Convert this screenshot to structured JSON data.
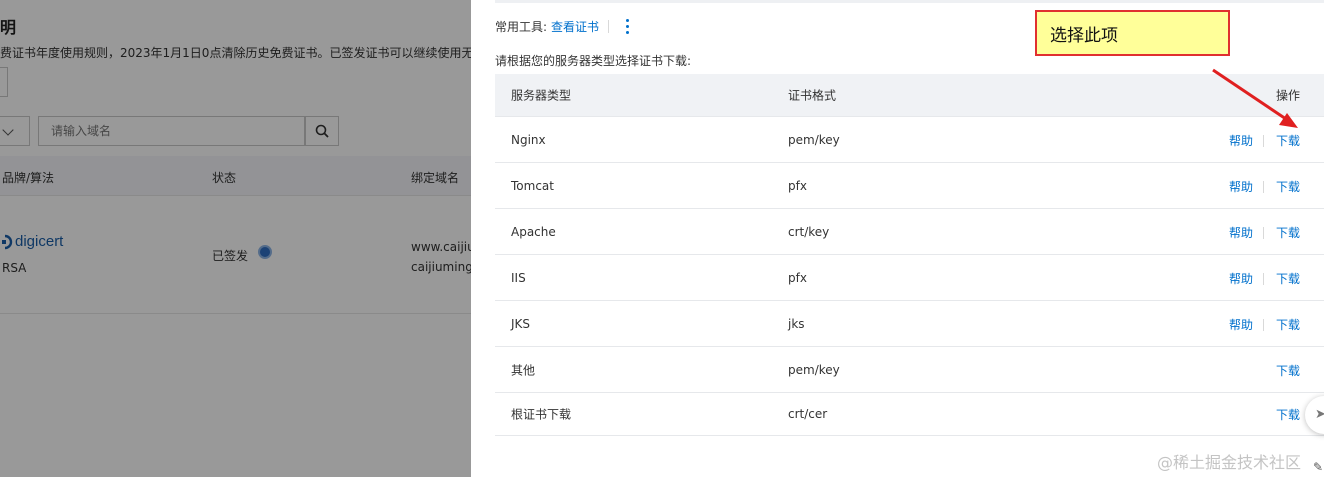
{
  "background_page": {
    "title": "明",
    "notice": "费证书年度使用规则，2023年1月1日0点清除历史免费证书。已签发证书可以继续使用无任",
    "search_placeholder": "请输入域名",
    "table_headers": {
      "brand": "品牌/算法",
      "status": "状态",
      "domain": "绑定域名"
    },
    "row": {
      "brand_logo_text": "digicert",
      "algorithm": "RSA",
      "status": "已签发",
      "domain_line1": "www.caijiun",
      "domain_line2": "caijiuming.c"
    }
  },
  "drawer": {
    "tools_label": "常用工具:",
    "tools_link": "查看证书",
    "hint": "请根据您的服务器类型选择证书下载:",
    "table": {
      "headers": {
        "server_type": "服务器类型",
        "cert_format": "证书格式",
        "actions": "操作"
      },
      "rows": [
        {
          "server_type": "Nginx",
          "cert_format": "pem/key",
          "help": "帮助",
          "download": "下载"
        },
        {
          "server_type": "Tomcat",
          "cert_format": "pfx",
          "help": "帮助",
          "download": "下载"
        },
        {
          "server_type": "Apache",
          "cert_format": "crt/key",
          "help": "帮助",
          "download": "下载"
        },
        {
          "server_type": "IIS",
          "cert_format": "pfx",
          "help": "帮助",
          "download": "下载"
        },
        {
          "server_type": "JKS",
          "cert_format": "jks",
          "help": "帮助",
          "download": "下载"
        },
        {
          "server_type": "其他",
          "cert_format": "pem/key",
          "help": "",
          "download": "下载"
        },
        {
          "server_type": "根证书下载",
          "cert_format": "crt/cer",
          "help": "",
          "download": "下载"
        }
      ]
    }
  },
  "annotation": {
    "callout_text": "选择此项",
    "color": "#e03030",
    "fill": "#ffff99"
  },
  "watermark": "@稀土掘金技术社区",
  "colors": {
    "link": "#0070cc",
    "header_bg": "#f0f2f5",
    "overlay": "rgba(0,0,0,0.40)"
  }
}
